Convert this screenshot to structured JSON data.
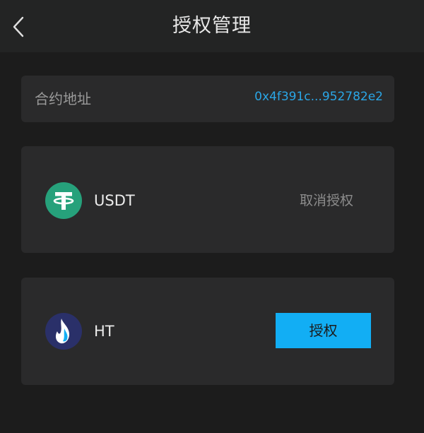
{
  "header": {
    "title": "授权管理",
    "back_icon": "chevron-left-icon"
  },
  "contract": {
    "label": "合约地址",
    "address": "0x4f391c...952782e2"
  },
  "tokens": [
    {
      "name": "USDT",
      "icon": "tether-icon",
      "action_label": "取消授权",
      "icon_color": "#26a17b"
    },
    {
      "name": "HT",
      "icon": "huobi-token-icon",
      "action_label": "授权",
      "icon_color": "#2a3069"
    }
  ],
  "colors": {
    "accent": "#12aef4",
    "link": "#2aa6e6",
    "card": "#2a2a2b",
    "background": "#1c1c1c"
  }
}
